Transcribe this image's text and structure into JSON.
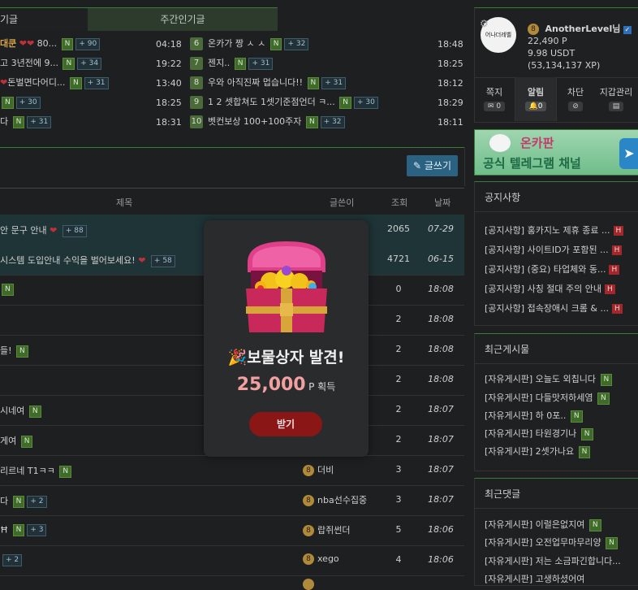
{
  "tabs": {
    "tab1": "기글",
    "tab2": "주간인기글"
  },
  "popular_left": [
    {
      "title": "대쿤",
      "rest": " 80...",
      "comments": "+ 90",
      "time": "04:18"
    },
    {
      "title": "고 3년전에 9...",
      "comments": "+ 34",
      "time": "19:22"
    },
    {
      "title": "돈벌면다어디...",
      "comments": "+ 31",
      "time": "13:40"
    },
    {
      "title": "",
      "comments": "+ 30",
      "time": "18:25"
    },
    {
      "title": "다",
      "comments": "+ 31",
      "time": "18:31"
    }
  ],
  "popular_right": [
    {
      "rank": "6",
      "title": "온카가 짱 ㅅ ㅅ",
      "comments": "+ 32",
      "time": "18:48"
    },
    {
      "rank": "7",
      "title": "젠지..",
      "comments": "+ 31",
      "time": "18:25"
    },
    {
      "rank": "8",
      "title": "우와 아직진짜 멉습니다!!",
      "comments": "+ 31",
      "time": "18:12"
    },
    {
      "rank": "9",
      "title": "1 2 셋합쳐도 1셋기준점언더 ㅋ...",
      "comments": "+ 30",
      "time": "18:29"
    },
    {
      "rank": "10",
      "title": "벳컨보상 100+100주자",
      "comments": "+ 32",
      "time": "18:11"
    }
  ],
  "new_badge": "N",
  "write_button": "글쓰기",
  "table_head": {
    "title": "제목",
    "author": "글쓴이",
    "views": "조회",
    "date": "날짜"
  },
  "posts": [
    {
      "title": "안 문구 안내",
      "comments": "+ 88",
      "author": "",
      "views": "2065",
      "date": "07-29",
      "notice": true
    },
    {
      "title": "시스템 도입안내 수익을 벌어보세요!",
      "comments": "+ 58",
      "author": "",
      "views": "4721",
      "date": "06-15",
      "notice": true
    },
    {
      "title": "",
      "comments": "",
      "author": "",
      "views": "0",
      "date": "18:08"
    },
    {
      "title": "",
      "comments": "",
      "author": "",
      "views": "2",
      "date": "18:08"
    },
    {
      "title": "들!",
      "comments": "",
      "author": "",
      "views": "2",
      "date": "18:08"
    },
    {
      "title": "",
      "comments": "",
      "author": "",
      "views": "2",
      "date": "18:08"
    },
    {
      "title": "시네여",
      "comments": "",
      "author": "",
      "views": "2",
      "date": "18:07"
    },
    {
      "title": "게여",
      "comments": "",
      "author": "",
      "views": "2",
      "date": "18:07"
    },
    {
      "title": "리르네 T1ㅋㅋ",
      "comments": "",
      "author": "더비",
      "views": "3",
      "date": "18:07"
    },
    {
      "title": "다",
      "comments": "+ 2",
      "author": "nba선수집중",
      "views": "3",
      "date": "18:07"
    },
    {
      "title": "Ħ",
      "comments": "+ 3",
      "author": "랍쥐썬더",
      "views": "5",
      "date": "18:06"
    },
    {
      "title": "",
      "comments": "+ 2",
      "author": "xego",
      "views": "4",
      "date": "18:06"
    }
  ],
  "profile": {
    "level_badge": "8",
    "avatar_text": "어나더레벨",
    "username": "AnotherLevel님",
    "points": "22,490 P",
    "usdt": "9.98 USDT",
    "xp": "(53,134,137 XP)"
  },
  "side_tabs": [
    {
      "label": "쪽지",
      "count": "0"
    },
    {
      "label": "알림",
      "count": "0"
    },
    {
      "label": "차단",
      "count": "⊘"
    },
    {
      "label": "지갑관리",
      "count": "▤"
    }
  ],
  "banner": {
    "line1": "온카판",
    "line2": "공식 텔레그램 채널"
  },
  "notices": {
    "title": "공지사항",
    "items": [
      {
        "prefix": "[공지사항]",
        "text": " 홍카지노 제휴 종료 ..."
      },
      {
        "prefix": "[공지사항]",
        "text": " 사이트ID가 포함된 ..."
      },
      {
        "prefix": "[공지사항]",
        "text": " (중요) 타업체와 동..."
      },
      {
        "prefix": "[공지사항]",
        "text": " 사칭 절대 주의 안내"
      },
      {
        "prefix": "[공지사항]",
        "text": " 접속장애시 크롬 & ..."
      }
    ],
    "badge": "H"
  },
  "recent_posts": {
    "title": "최근게시물",
    "items": [
      {
        "prefix": "[자유게시판]",
        "text": " 오늘도 외칩니다"
      },
      {
        "prefix": "[자유게시판]",
        "text": " 다들맛저하세염"
      },
      {
        "prefix": "[자유게시판]",
        "text": " 하 0포.."
      },
      {
        "prefix": "[자유게시판]",
        "text": " 타원경기나"
      },
      {
        "prefix": "[자유게시판]",
        "text": " 2셋가나요"
      }
    ]
  },
  "recent_comments": {
    "title": "최근댓글",
    "items": [
      {
        "prefix": "[자유게시판]",
        "text": " 이럴은없지여"
      },
      {
        "prefix": "[자유게시판]",
        "text": " 오전업무마무리양"
      },
      {
        "prefix": "[자유게시판]",
        "text": " 저는 소금파긴합니다..."
      },
      {
        "prefix": "[자유게시판]",
        "text": " 고생하셨어여"
      }
    ]
  },
  "popup": {
    "title": "보물상자 발견!",
    "amount": "25,000",
    "unit": "P 획득",
    "button": "받기"
  },
  "colors": {
    "accent_green": "#3a7a3a",
    "notice_row": "#1f3437",
    "popup_button": "#8b1616",
    "reward": "#f3a0a0"
  }
}
